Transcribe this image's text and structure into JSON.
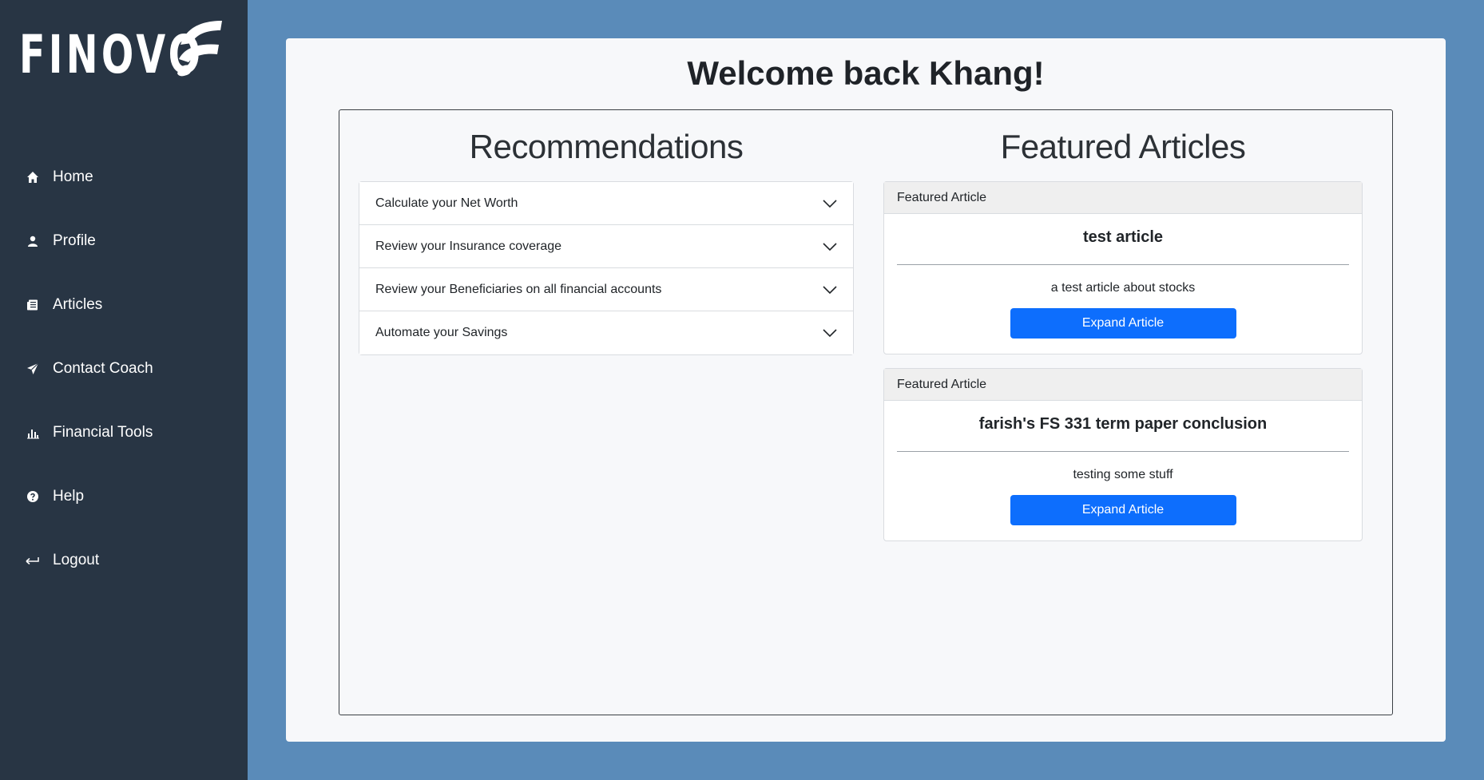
{
  "brand": {
    "name": "FINOVO",
    "mark_icon": "finovo-f-logo"
  },
  "sidebar": {
    "items": [
      {
        "label": "Home",
        "icon": "home-icon"
      },
      {
        "label": "Profile",
        "icon": "person-icon"
      },
      {
        "label": "Articles",
        "icon": "newspaper-icon"
      },
      {
        "label": "Contact Coach",
        "icon": "send-icon"
      },
      {
        "label": "Financial Tools",
        "icon": "bar-chart-icon"
      },
      {
        "label": "Help",
        "icon": "question-circle-icon"
      },
      {
        "label": "Logout",
        "icon": "logout-arrow-icon"
      }
    ]
  },
  "main": {
    "welcome": "Welcome back Khang!",
    "recommendations": {
      "title": "Recommendations",
      "items": [
        "Calculate your Net Worth",
        "Review your Insurance coverage",
        "Review your Beneficiaries on all financial accounts",
        "Automate your Savings"
      ]
    },
    "featured": {
      "title": "Featured Articles",
      "articles": [
        {
          "header": "Featured Article",
          "name": "test article",
          "description": "a test article about stocks",
          "button": "Expand Article"
        },
        {
          "header": "Featured Article",
          "name": "farish's FS 331 term paper conclusion",
          "description": "testing some stuff",
          "button": "Expand Article"
        }
      ]
    }
  },
  "colors": {
    "sidebar_bg": "#283544",
    "page_bg": "#5a8bb9",
    "card_bg": "#f7f8fa",
    "primary_button": "#0d6efd"
  }
}
